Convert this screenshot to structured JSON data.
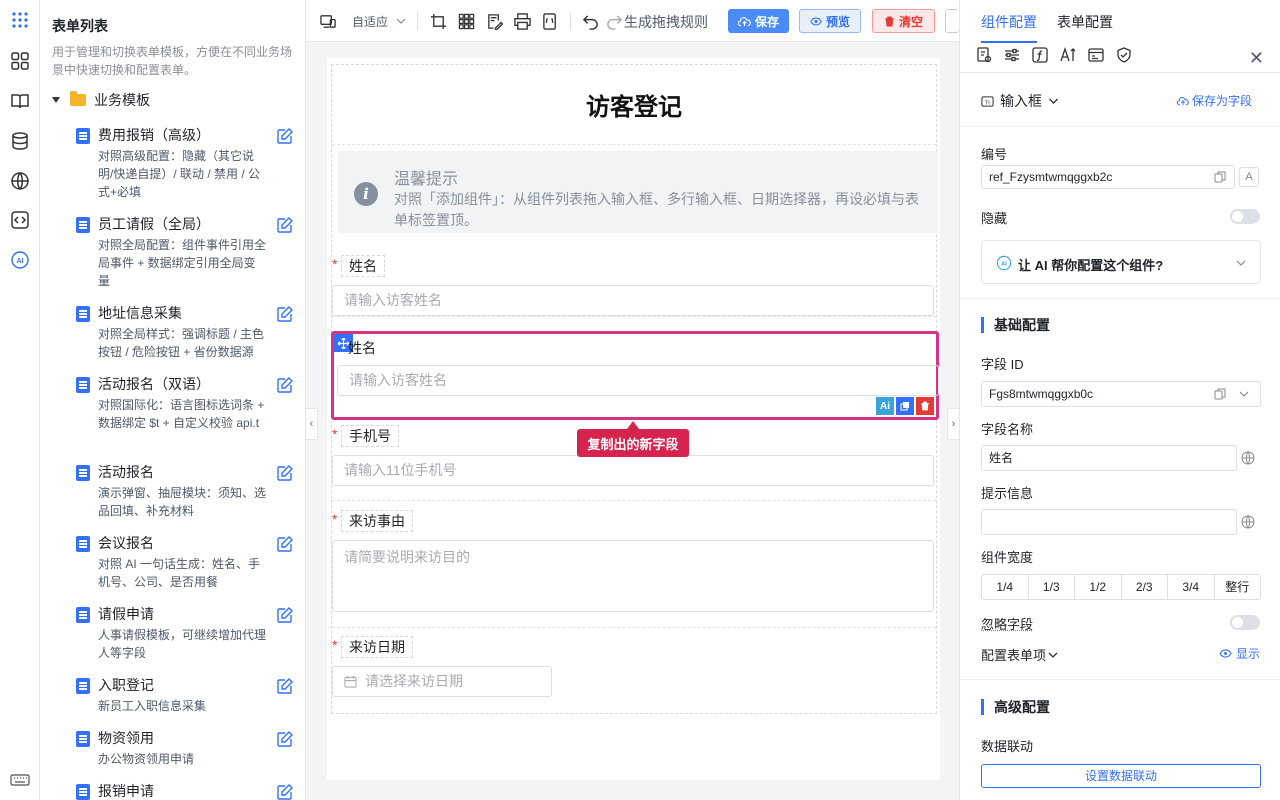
{
  "left_panel": {
    "title": "表单列表",
    "description": "用于管理和切换表单模板，方便在不同业务场景中快速切换和配置表单。",
    "folder": "业务模板",
    "templates": [
      {
        "name": "费用报销（高级）",
        "desc": "对照高级配置：隐藏（其它说明/快递自提）/ 联动 / 禁用 / 公式+必填"
      },
      {
        "name": "员工请假（全局）",
        "desc": "对照全局配置：组件事件引用全局事件 + 数据绑定引用全局变量"
      },
      {
        "name": "地址信息采集",
        "desc": "对照全局样式：强调标题 / 主色按钮 / 危险按钮 + 省份数据源"
      },
      {
        "name": "活动报名（双语）",
        "desc": "对照国际化：语言图标选词条 + 数据绑定 $t + 自定义校验 api.t"
      },
      {
        "name": "活动报名",
        "desc": "演示弹窗、抽屉模块：须知、选品回填、补充材料"
      },
      {
        "name": "会议报名",
        "desc": "对照 AI 一句话生成：姓名、手机号、公司、是否用餐"
      },
      {
        "name": "请假申请",
        "desc": "人事请假模板，可继续增加代理人等字段"
      },
      {
        "name": "入职登记",
        "desc": "新员工入职信息采集"
      },
      {
        "name": "物资领用",
        "desc": "办公物资领用申请"
      },
      {
        "name": "报销申请",
        "desc": ""
      }
    ]
  },
  "toolbar": {
    "adapt": "自适应",
    "rule": "生成拖拽规则",
    "save": "保存",
    "preview": "预览",
    "clear": "清空"
  },
  "form": {
    "title": "访客登记",
    "tip_title": "温馨提示",
    "tip_desc": "对照「添加组件」：从组件列表拖入输入框、多行输入框、日期选择器，再设必填与表单标签置顶。",
    "fields": [
      {
        "label": "姓名",
        "placeholder": "请输入访客姓名"
      },
      {
        "label": "手机号",
        "placeholder": "请输入11位手机号"
      },
      {
        "label": "来访事由",
        "placeholder": "请简要说明来访目的"
      },
      {
        "label": "来访日期",
        "placeholder": "请选择来访日期"
      }
    ],
    "selected": {
      "label": "姓名",
      "placeholder": "请输入访客姓名",
      "ai": "Ai"
    },
    "toast": "复制出的新字段",
    "required_mark": "*"
  },
  "right_panel": {
    "tab_component": "组件配置",
    "tab_form": "表单配置",
    "comp_type": "输入框",
    "save_as_field": "保存为字段",
    "id_label": "编号",
    "id_value": "ref_Fzysmtwmqggxb2c",
    "hidden_label": "隐藏",
    "ai_prompt": "让 AI 帮你配置这个组件?",
    "basic_section": "基础配置",
    "field_id_label": "字段 ID",
    "field_id_value": "Fgs8mtwmqggxb0c",
    "field_name_label": "字段名称",
    "field_name_value": "姓名",
    "tip_label": "提示信息",
    "width_label": "组件宽度",
    "widths": [
      "1/4",
      "1/3",
      "1/2",
      "2/3",
      "3/4",
      "整行"
    ],
    "ignore_label": "忽略字段",
    "config_items_label": "配置表单项",
    "show_label": "显示",
    "advanced_section": "高级配置",
    "linkage_label": "数据联动",
    "linkage_button": "设置数据联动"
  },
  "colors": {
    "primary": "#3370ff",
    "danger": "#e53935",
    "highlight": "#d63384"
  }
}
